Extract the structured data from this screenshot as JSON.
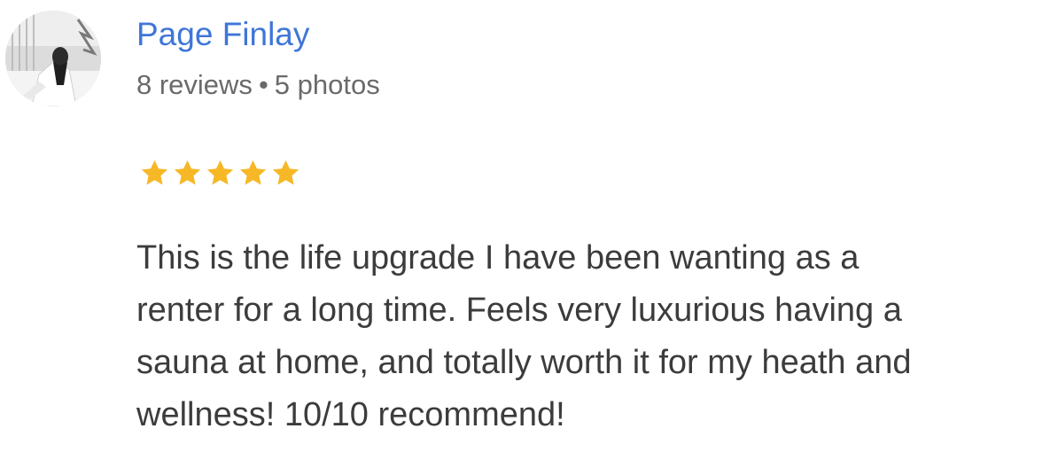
{
  "reviewer": {
    "name": "Page Finlay",
    "reviews_text": "8 reviews",
    "separator": "•",
    "photos_text": "5 photos"
  },
  "rating": {
    "stars": 5,
    "max": 5,
    "color": "#F6B827"
  },
  "review": {
    "text": "This is the life upgrade I have been wanting as a\nrenter for a long time. Feels very luxurious having a\nsauna at home, and totally worth it for my heath and\nwellness! 10/10 recommend!"
  },
  "colors": {
    "name": "#3F76D8",
    "meta": "#6A6A6A",
    "body": "#3C3C3C"
  }
}
